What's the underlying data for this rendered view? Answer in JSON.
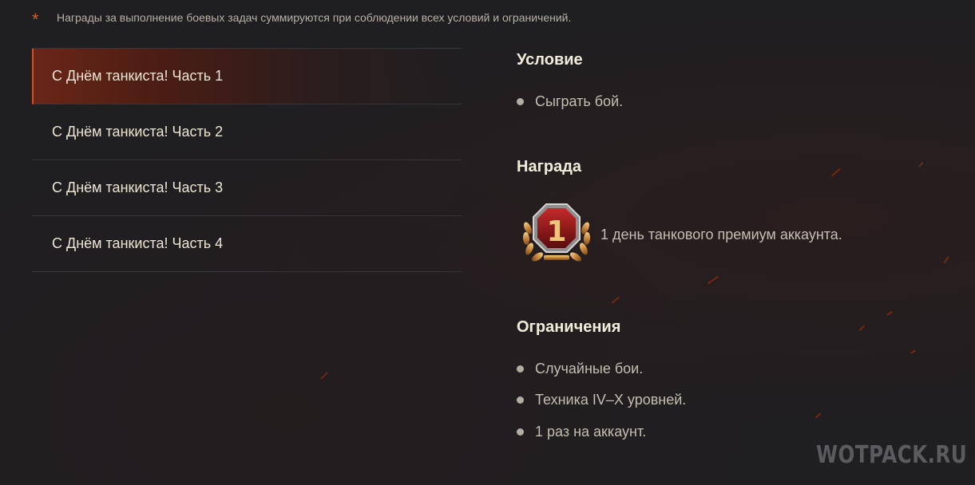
{
  "note": {
    "marker": "*",
    "text": "Награды за выполнение боевых задач суммируются при соблюдении всех условий и ограничений."
  },
  "tabs": [
    {
      "label": "С Днём танкиста! Часть 1",
      "active": true
    },
    {
      "label": "С Днём танкиста! Часть 2",
      "active": false
    },
    {
      "label": "С Днём танкиста! Часть 3",
      "active": false
    },
    {
      "label": "С Днём танкиста! Часть 4",
      "active": false
    }
  ],
  "condition": {
    "title": "Условие",
    "items": [
      "Сыграть бой."
    ]
  },
  "reward": {
    "title": "Награда",
    "badge_icon": "premium-account-laurel-badge",
    "badge_number": "1",
    "text": "1 день танкового премиум аккаунта."
  },
  "restrictions": {
    "title": "Ограничения",
    "items": [
      "Случайные бои.",
      "Техника IV–X уровней.",
      "1 раз на аккаунт."
    ]
  },
  "watermark": "WOTPACK.RU",
  "colors": {
    "background": "#1f1e21",
    "accent": "#d24b22",
    "heading": "#f2ecdd",
    "text": "#c4beb2"
  }
}
